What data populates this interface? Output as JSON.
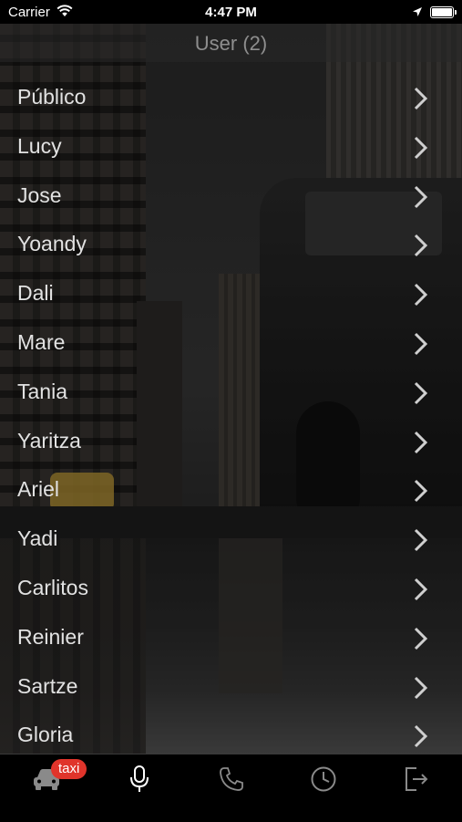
{
  "status_bar": {
    "carrier": "Carrier",
    "time": "4:47 PM"
  },
  "header": {
    "title": "User (2)"
  },
  "users": [
    {
      "name": "Público"
    },
    {
      "name": "Lucy"
    },
    {
      "name": "Jose"
    },
    {
      "name": "Yoandy"
    },
    {
      "name": "Dali"
    },
    {
      "name": "Mare"
    },
    {
      "name": "Tania"
    },
    {
      "name": "Yaritza"
    },
    {
      "name": "Ariel"
    },
    {
      "name": "Yadi"
    },
    {
      "name": "Carlitos"
    },
    {
      "name": "Reinier"
    },
    {
      "name": "Sartze"
    },
    {
      "name": "Gloria"
    }
  ],
  "tab_bar": {
    "taxi_badge": "taxi",
    "tabs": [
      {
        "icon": "taxi-icon",
        "active": false
      },
      {
        "icon": "microphone-icon",
        "active": true
      },
      {
        "icon": "phone-icon",
        "active": false
      },
      {
        "icon": "history-clock-icon",
        "active": false
      },
      {
        "icon": "logout-icon",
        "active": false
      }
    ]
  },
  "colors": {
    "badge": "#e0342b",
    "tab_active": "#ffffff",
    "tab_inactive": "#8a8a8a",
    "list_text": "#e2e2e2"
  }
}
